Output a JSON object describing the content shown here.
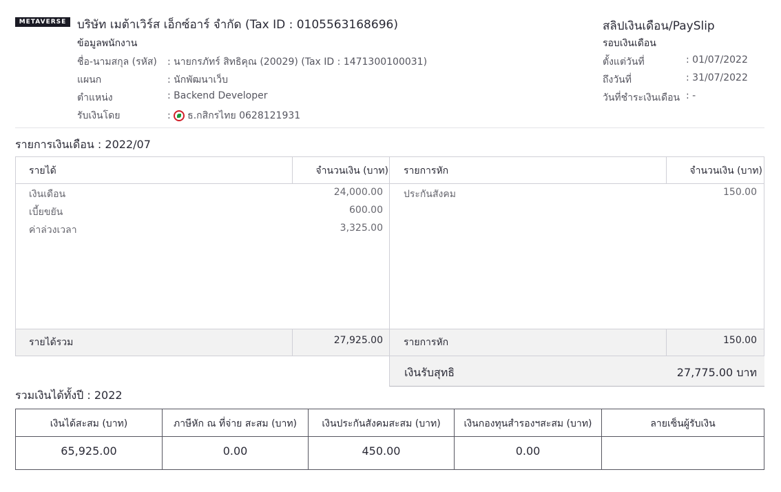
{
  "header": {
    "logo_text": "METAVERSE",
    "company": "บริษัท เมต้าเวิร์ส เอ็กซ์อาร์ จำกัด (Tax ID : 0105563168696)",
    "employee_section_title": "ข้อมูลพนักงาน",
    "slip_title": "สลิปเงินเดือน/PaySlip",
    "period_section_title": "รอบเงินเดือน"
  },
  "employee": {
    "name_label": "ชื่อ-นามสกุล (รหัส)",
    "name_value": ": นายกรภัทร์ สิทธิคุณ (20029) (Tax ID : 1471300100031)",
    "dept_label": "แผนก",
    "dept_value": ": นักพัฒนาเว็บ",
    "position_label": "ตำแหน่ง",
    "position_value": ": Backend Developer",
    "pay_by_label": "รับเงินโดย",
    "pay_by_prefix": ":",
    "pay_by_value": "ธ.กสิกรไทย 0628121931",
    "bank_icon": "kasikorn-bank-icon"
  },
  "period": {
    "from_label": "ตั้งแต่วันที่",
    "from_value": ": 01/07/2022",
    "to_label": "ถึงวันที่",
    "to_value": ": 31/07/2022",
    "paid_label": "วันที่ชำระเงินเดือน",
    "paid_value": ": -"
  },
  "salary": {
    "title": "รายการเงินเดือน : 2022/07",
    "income_header": "รายได้",
    "income_amount_header": "จำนวนเงิน (บาท)",
    "deduct_header": "รายการหัก",
    "deduct_amount_header": "จำนวนเงิน (บาท)",
    "income_items": [
      {
        "label": "เงินเดือน",
        "amount": "24,000.00"
      },
      {
        "label": "เบี้ยขยัน",
        "amount": "600.00"
      },
      {
        "label": "ค่าล่วงเวลา",
        "amount": "3,325.00"
      }
    ],
    "deduct_items": [
      {
        "label": "ประกันสังคม",
        "amount": "150.00"
      }
    ],
    "income_total_label": "รายได้รวม",
    "income_total": "27,925.00",
    "deduct_total_label": "รายการหัก",
    "deduct_total": "150.00",
    "net_label": "เงินรับสุทธิ",
    "net_value": "27,775.00 บาท"
  },
  "yearly": {
    "title": "รวมเงินได้ทั้งปี : 2022",
    "headers": [
      "เงินได้สะสม (บาท)",
      "ภาษีหัก ณ ที่จ่าย สะสม (บาท)",
      "เงินประกันสังคมสะสม (บาท)",
      "เงินกองทุนสำรองฯสะสม (บาท)",
      "ลายเซ็นผู้รับเงิน"
    ],
    "values": [
      "65,925.00",
      "0.00",
      "450.00",
      "0.00",
      ""
    ]
  }
}
